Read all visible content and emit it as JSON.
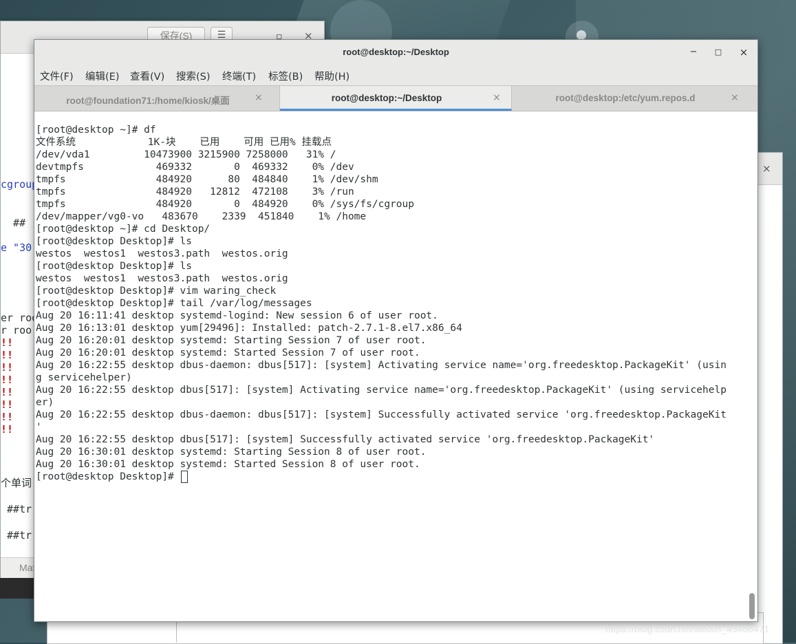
{
  "back_editor": {
    "save_label": "保存(S)",
    "menu_glyph": "☰",
    "close_glyph": "×",
    "maximize_glyph": "▫",
    "text_fragments": [
      {
        "text": "cgroup",
        "color": "#2a3fbf"
      },
      {
        "text": "  ##",
        "color": "#2e3436"
      },
      {
        "text": "e \"30",
        "color": "#2a3fbf"
      },
      {
        "text": "er roo",
        "color": "#2e3436"
      },
      {
        "text": "r roo",
        "color": "#2e3436"
      },
      {
        "text": "!!",
        "color": "#cc0000"
      },
      {
        "text": "!!",
        "color": "#cc0000"
      },
      {
        "text": "!!",
        "color": "#cc0000"
      },
      {
        "text": "!!",
        "color": "#cc0000"
      },
      {
        "text": "!!",
        "color": "#cc0000"
      },
      {
        "text": "!!",
        "color": "#cc0000"
      },
      {
        "text": "!!",
        "color": "#cc0000"
      },
      {
        "text": "!!",
        "color": "#cc0000"
      },
      {
        "text": "个单词",
        "color": "#2e3436"
      },
      {
        "text": " ##tr",
        "color": "#2e3436"
      },
      {
        "text": " ##tr",
        "color": "#2e3436"
      }
    ],
    "status_label": "Mat"
  },
  "terminal": {
    "title": "root@desktop:~/Desktop",
    "window_buttons": {
      "minimize": "−",
      "maximize": "□",
      "close": "×"
    },
    "menu": [
      "文件(F)",
      "编辑(E)",
      "查看(V)",
      "搜索(S)",
      "终端(T)",
      "标签(B)",
      "帮助(H)"
    ],
    "tabs": [
      {
        "label": "root@foundation71:/home/kiosk/桌面",
        "active": false
      },
      {
        "label": "root@desktop:~/Desktop",
        "active": true
      },
      {
        "label": "root@desktop:/etc/yum.repos.d",
        "active": false
      }
    ],
    "tab_close_glyph": "×",
    "lines": [
      "[root@desktop ~]# df",
      "文件系统            1K-块    已用    可用 已用% 挂载点",
      "/dev/vda1         10473900 3215900 7258000   31% /",
      "devtmpfs            469332       0  469332    0% /dev",
      "tmpfs               484920      80  484840    1% /dev/shm",
      "tmpfs               484920   12812  472108    3% /run",
      "tmpfs               484920       0  484920    0% /sys/fs/cgroup",
      "/dev/mapper/vg0-vo   483670    2339  451840    1% /home",
      "[root@desktop ~]# cd Desktop/",
      "[root@desktop Desktop]# ls",
      "westos  westos1  westos3.path  westos.orig",
      "[root@desktop Desktop]# ls",
      "westos  westos1  westos3.path  westos.orig",
      "[root@desktop Desktop]# vim waring_check",
      "[root@desktop Desktop]# tail /var/log/messages",
      "Aug 20 16:11:41 desktop systemd-logind: New session 6 of user root.",
      "Aug 20 16:13:01 desktop yum[29496]: Installed: patch-2.7.1-8.el7.x86_64",
      "Aug 20 16:20:01 desktop systemd: Starting Session 7 of user root.",
      "Aug 20 16:20:01 desktop systemd: Started Session 7 of user root.",
      "Aug 20 16:22:55 desktop dbus-daemon: dbus[517]: [system] Activating service name='org.freedesktop.PackageKit' (usin",
      "g servicehelper)",
      "Aug 20 16:22:55 desktop dbus[517]: [system] Activating service name='org.freedesktop.PackageKit' (using servicehelp",
      "er)",
      "Aug 20 16:22:55 desktop dbus-daemon: dbus[517]: [system] Successfully activated service 'org.freedesktop.PackageKit",
      "'",
      "Aug 20 16:22:55 desktop dbus[517]: [system] Successfully activated service 'org.freedesktop.PackageKit'",
      "Aug 20 16:30:01 desktop systemd: Starting Session 8 of user root.",
      "Aug 20 16:30:01 desktop systemd: Started Session 8 of user root."
    ],
    "prompt": "[root@desktop Desktop]# "
  },
  "right_window": {
    "close_glyph": "×"
  },
  "watermark": "https://blog.csdn.net/weixin_45466471"
}
